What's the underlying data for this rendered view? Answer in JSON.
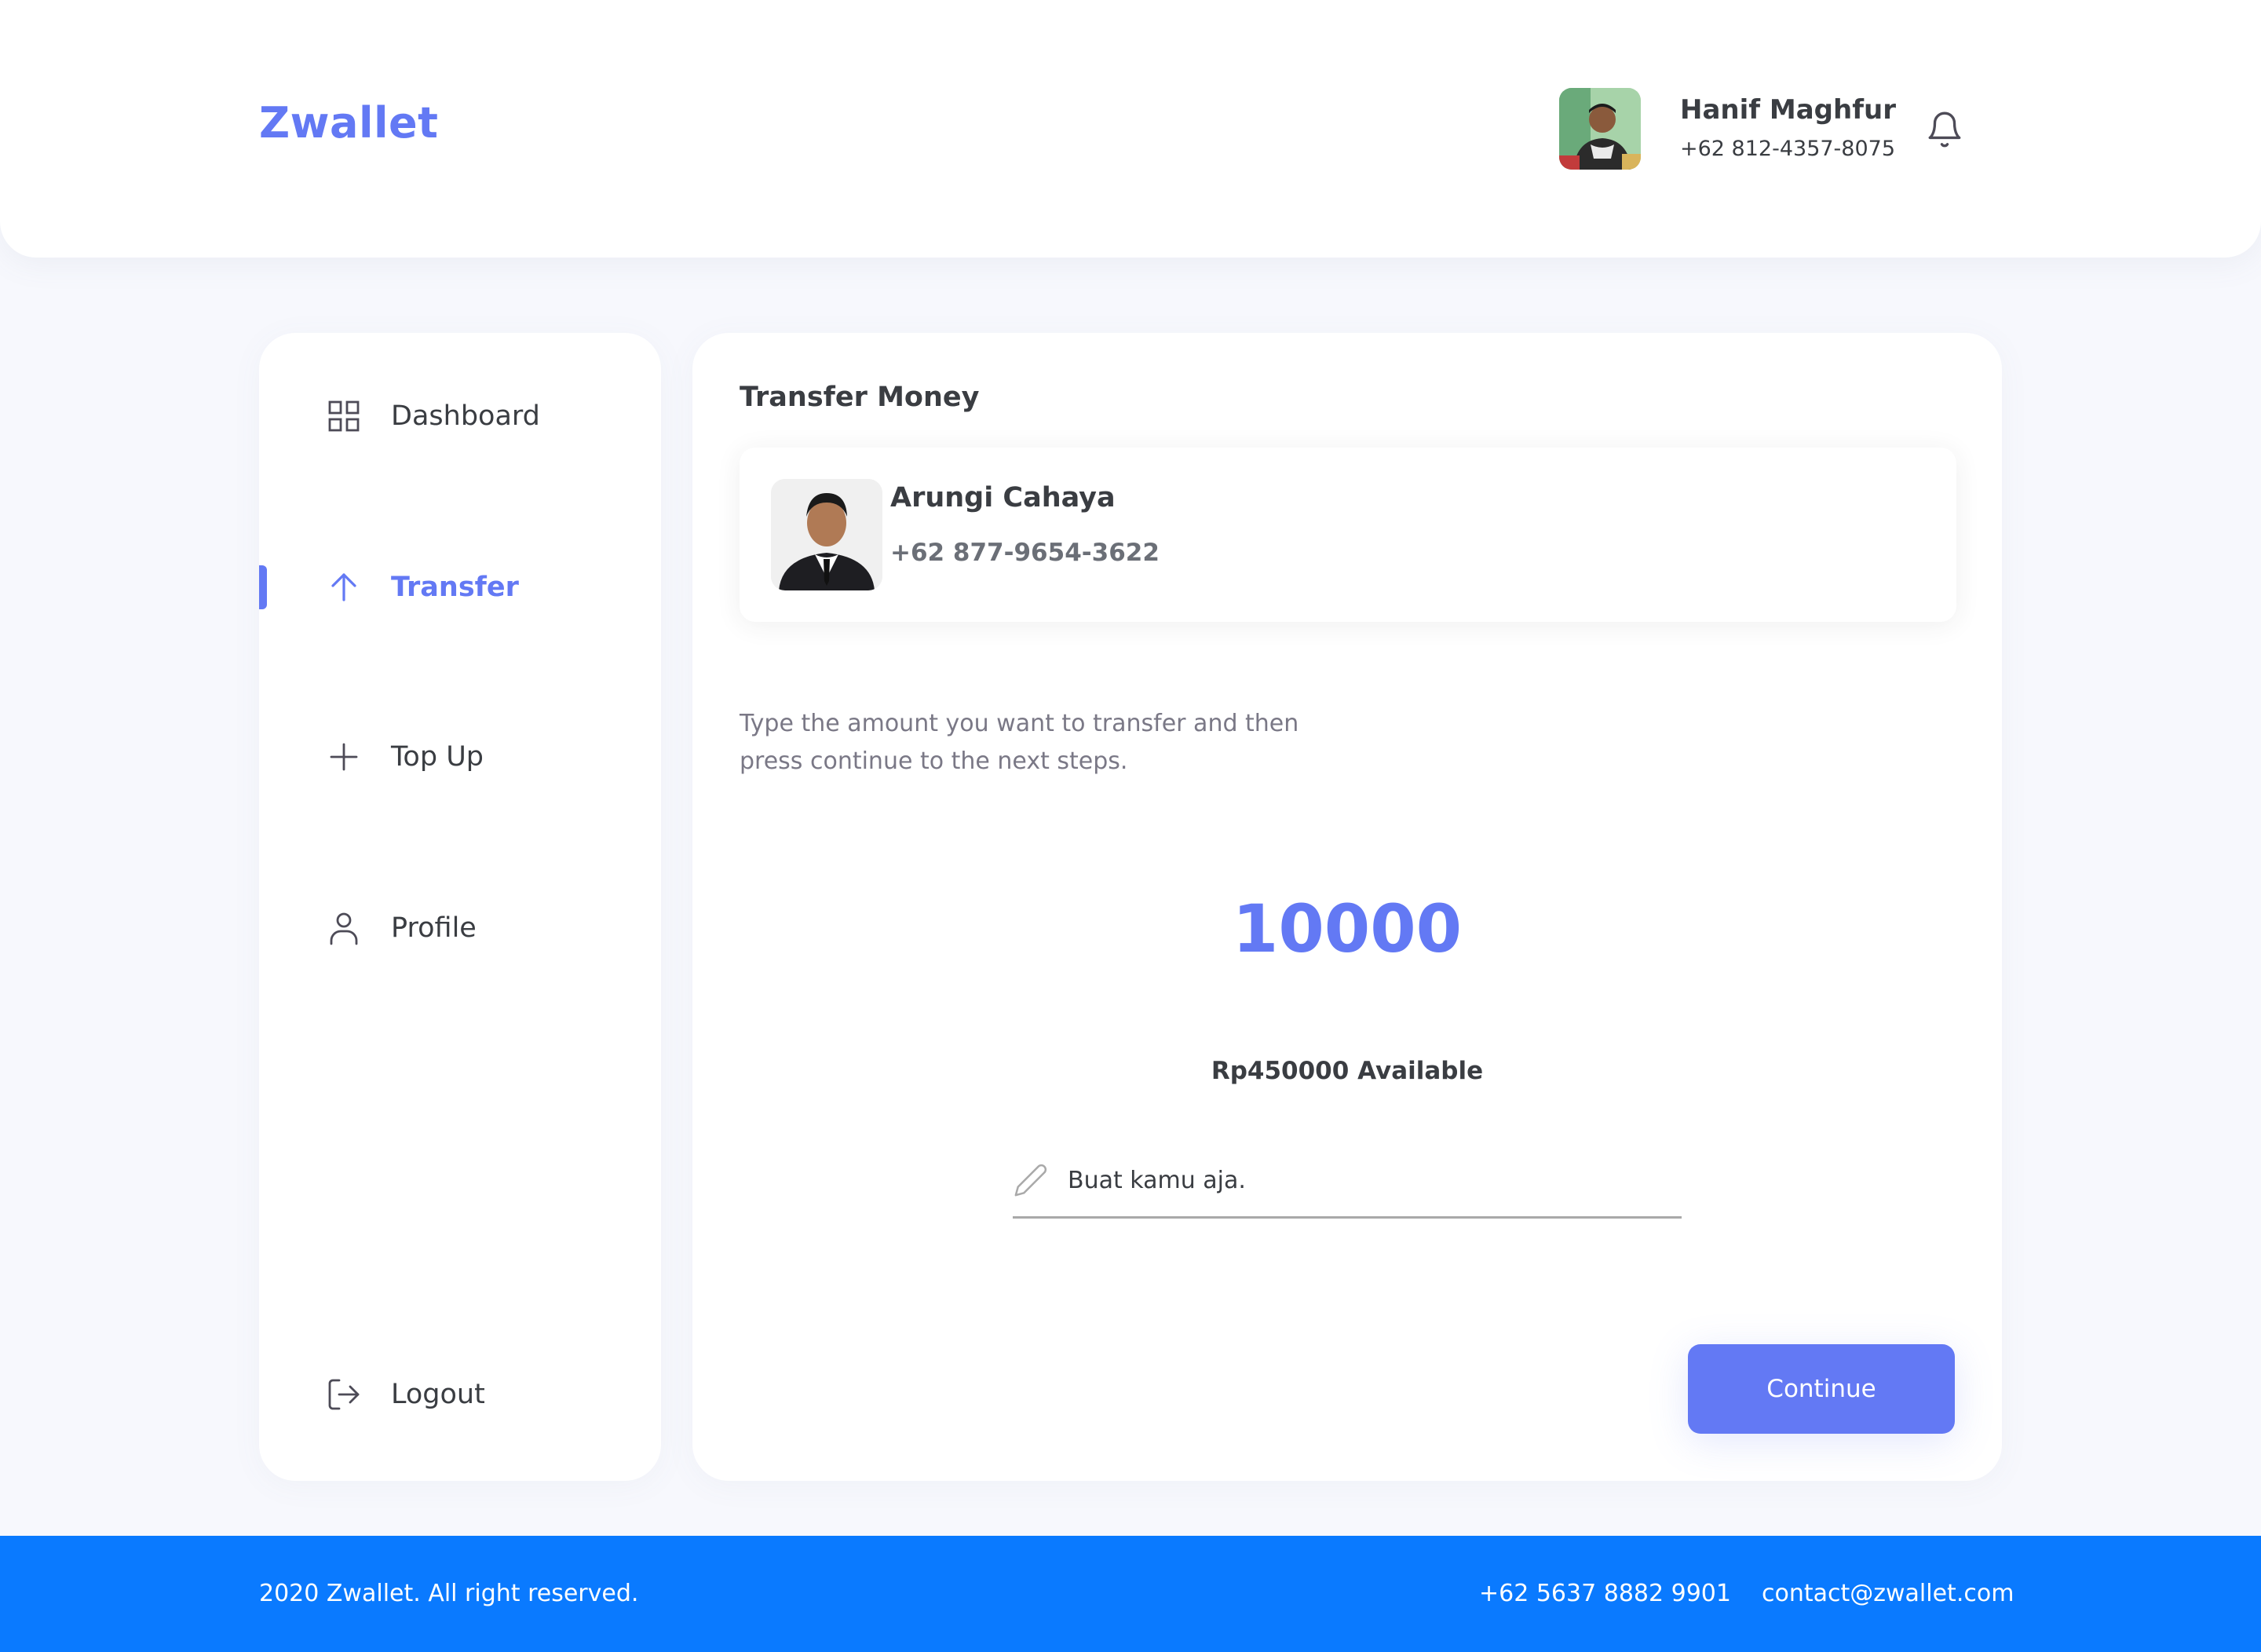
{
  "header": {
    "brand": "Zwallet",
    "user": {
      "name": "Hanif Maghfur",
      "phone": "+62 812-4357-8075"
    },
    "notification_icon": "bell-icon"
  },
  "sidebar": {
    "items": [
      {
        "label": "Dashboard",
        "icon": "grid-icon",
        "active": false
      },
      {
        "label": "Transfer",
        "icon": "arrow-up-icon",
        "active": true
      },
      {
        "label": "Top Up",
        "icon": "plus-icon",
        "active": false
      },
      {
        "label": "Profile",
        "icon": "user-icon",
        "active": false
      }
    ],
    "logout": {
      "label": "Logout",
      "icon": "logout-icon"
    }
  },
  "main": {
    "title": "Transfer Money",
    "recipient": {
      "name": "Arungi Cahaya",
      "phone": "+62 877-9654-3622"
    },
    "instructions": "Type the amount you want to transfer and then press continue to the next steps.",
    "amount": "10000",
    "available": "Rp450000 Available",
    "note": {
      "value": "Buat kamu aja.",
      "icon": "pencil-icon"
    },
    "continue_label": "Continue"
  },
  "footer": {
    "copyright": "2020 Zwallet. All right reserved.",
    "phone": "+62 5637 8882 9901",
    "email": "contact@zwallet.com"
  },
  "colors": {
    "primary": "#6379f4",
    "footer": "#0a7aff",
    "background": "#f7f8fd",
    "text": "#3a3d42"
  }
}
